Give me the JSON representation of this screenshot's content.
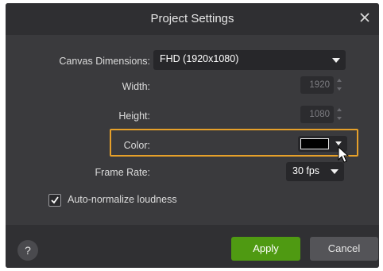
{
  "dialog": {
    "title": "Project Settings",
    "close_icon": "close-icon"
  },
  "canvas_dimensions": {
    "label": "Canvas Dimensions:",
    "value": "FHD (1920x1080)"
  },
  "width": {
    "label": "Width:",
    "value": "1920"
  },
  "height": {
    "label": "Height:",
    "value": "1080"
  },
  "color": {
    "label": "Color:",
    "swatch_color": "#000000",
    "highlight_color": "#e6a02a"
  },
  "frame_rate": {
    "label": "Frame Rate:",
    "value": "30 fps"
  },
  "auto_normalize": {
    "label": "Auto-normalize loudness",
    "checked": true
  },
  "footer": {
    "help_label": "?",
    "apply_label": "Apply",
    "cancel_label": "Cancel",
    "apply_color": "#4f9a12"
  }
}
